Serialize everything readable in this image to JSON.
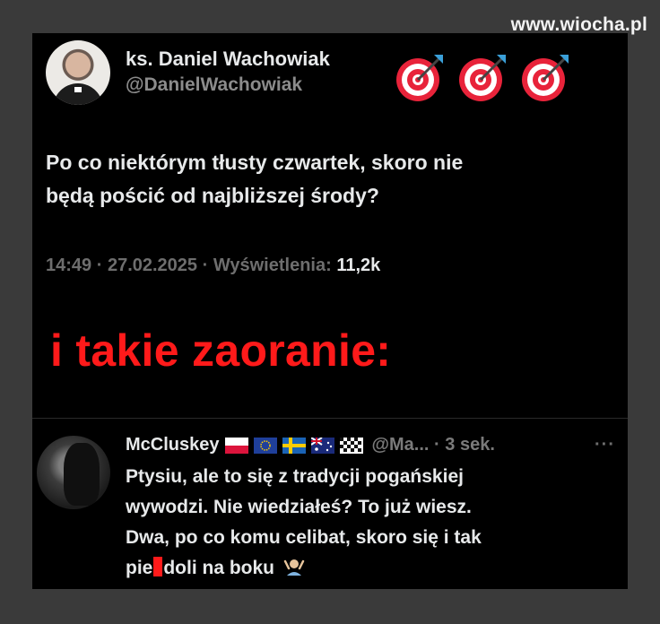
{
  "watermark": "www.wiocha.pl",
  "tweet": {
    "author_name": "ks. Daniel Wachowiak",
    "author_handle": "@DanielWachowiak",
    "text_line1": "Po co niektórym tłusty czwartek, skoro nie",
    "text_line2": "będą pościć od najbliższej środy?",
    "time": "14:49",
    "date": "27.02.2025",
    "views_label": "Wyświetlenia:",
    "views_count": "11,2k",
    "separator": "·"
  },
  "caption": "i takie zaoranie:",
  "reply": {
    "author_name": "McCluskey",
    "flags": [
      "poland-flag",
      "eu-flag",
      "sweden-flag",
      "australia-flag",
      "checkered-flag"
    ],
    "handle": "@Ma...",
    "separator": "·",
    "time": "3 sek.",
    "more": "···",
    "line1": "Ptysiu, ale to się z tradycji pogańskiej",
    "line2": "wywodzi. Nie wiedziałeś? To już wiesz.",
    "line3": "Dwa, po co komu celibat, skoro się i tak",
    "line4_a": "pie",
    "line4_b": "doli na boku"
  },
  "colors": {
    "background": "#000000",
    "caption_red": "#ff1a1a",
    "text": "#e7e9ea",
    "muted": "#6e6e6e"
  },
  "icons": [
    "direct-hit-icon",
    "shrug-emoji-icon"
  ]
}
